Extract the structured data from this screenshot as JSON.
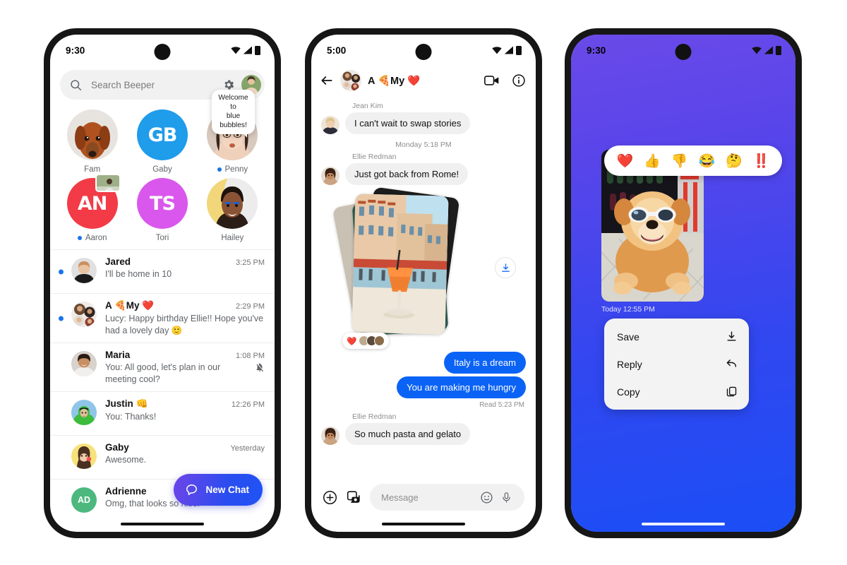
{
  "phone1": {
    "status": {
      "time": "9:30",
      "icons": [
        "wifi-icon",
        "signal-icon",
        "battery-icon"
      ]
    },
    "search": {
      "placeholder": "Search Beeper",
      "icon": "search-icon",
      "settings_icon": "gear-icon",
      "avatar": "profile-avatar"
    },
    "stories": [
      {
        "name": "Fam",
        "kind": "photo",
        "unread": false,
        "tooltip": ""
      },
      {
        "name": "Gaby",
        "kind": "initials",
        "initials": "GB",
        "color": "#1f9cea",
        "unread": false,
        "tooltip": ""
      },
      {
        "name": "Penny",
        "kind": "photo",
        "unread": true,
        "tooltip": "Welcome to\nblue bubbles!"
      },
      {
        "name": "Aaron",
        "kind": "initials",
        "initials": "AN",
        "color": "#f23b46",
        "unread": true,
        "tooltip": ""
      },
      {
        "name": "Tori",
        "kind": "initials",
        "initials": "TS",
        "color": "#d957ec",
        "unread": false,
        "tooltip": ""
      },
      {
        "name": "Hailey",
        "kind": "photo",
        "unread": false,
        "tooltip": ""
      }
    ],
    "chats": [
      {
        "name": "Jared",
        "emoji": "",
        "time": "3:25 PM",
        "preview": "I'll be home in 10",
        "unread": true,
        "muted": false,
        "avatar_kind": "photo",
        "initials": "",
        "color": ""
      },
      {
        "name": "A 🍕My ❤️",
        "emoji": "",
        "time": "2:29 PM",
        "preview": "Lucy: Happy birthday Ellie!! Hope you've had a lovely day  🙂",
        "unread": true,
        "muted": false,
        "avatar_kind": "group",
        "initials": "",
        "color": ""
      },
      {
        "name": "Maria",
        "emoji": "",
        "time": "1:08 PM",
        "preview": "You: All good, let's plan in our meeting cool?",
        "unread": false,
        "muted": true,
        "avatar_kind": "photo",
        "initials": "",
        "color": ""
      },
      {
        "name": "Justin 👊",
        "emoji": "",
        "time": "12:26 PM",
        "preview": "You: Thanks!",
        "unread": false,
        "muted": false,
        "avatar_kind": "photo",
        "initials": "",
        "color": ""
      },
      {
        "name": "Gaby",
        "emoji": "",
        "time": "Yesterday",
        "preview": "Awesome.",
        "unread": false,
        "muted": false,
        "avatar_kind": "photo",
        "initials": "",
        "color": ""
      },
      {
        "name": "Adrienne",
        "emoji": "",
        "time": "",
        "preview": "Omg, that looks so nice!",
        "unread": false,
        "muted": false,
        "avatar_kind": "initials",
        "initials": "AD",
        "color": "#4db87e"
      }
    ],
    "fab": {
      "label": "New Chat",
      "icon": "chat-bubble-icon",
      "gradient_start": "#6d45e8",
      "gradient_end": "#1f53f5"
    }
  },
  "phone2": {
    "status": {
      "time": "5:00"
    },
    "header": {
      "back_icon": "back-arrow-icon",
      "title": "A 🍕My ❤️",
      "video_icon": "video-camera-icon",
      "info_icon": "info-icon",
      "avatar": "group-avatar"
    },
    "messages": [
      {
        "type": "incoming",
        "sender": "Jean Kim",
        "text": "I can't wait to swap stories"
      },
      {
        "type": "daystamp",
        "text": "Monday 5:18 PM"
      },
      {
        "type": "incoming",
        "sender": "Ellie Redman",
        "text": "Just got back from Rome!"
      },
      {
        "type": "photostack",
        "reaction": "❤️",
        "download_icon": "download-icon"
      },
      {
        "type": "outgoing",
        "text": "Italy is a dream"
      },
      {
        "type": "outgoing",
        "text": "You are making me hungry"
      },
      {
        "type": "readstamp",
        "text": "Read  5:23 PM"
      },
      {
        "type": "incoming",
        "sender": "Ellie Redman",
        "text": "So much pasta and gelato"
      }
    ],
    "composer": {
      "plus_icon": "plus-circle-icon",
      "gallery_icon": "gallery-icon",
      "placeholder": "Message",
      "emoji_icon": "emoji-icon",
      "mic_icon": "microphone-icon"
    }
  },
  "phone3": {
    "status": {
      "time": "9:30"
    },
    "background": {
      "gradient_start": "#6a4ae8",
      "gradient_end": "#1b4ef6"
    },
    "reactions": [
      "❤️",
      "👍",
      "👎",
      "😂",
      "🤔",
      "‼️"
    ],
    "photo": {
      "caption": "Today  12:55 PM",
      "alt": "dog-with-sunglasses-photo"
    },
    "context_menu": [
      {
        "label": "Save",
        "icon": "download-icon"
      },
      {
        "label": "Reply",
        "icon": "reply-arrow-icon"
      },
      {
        "label": "Copy",
        "icon": "copy-icon"
      }
    ]
  }
}
